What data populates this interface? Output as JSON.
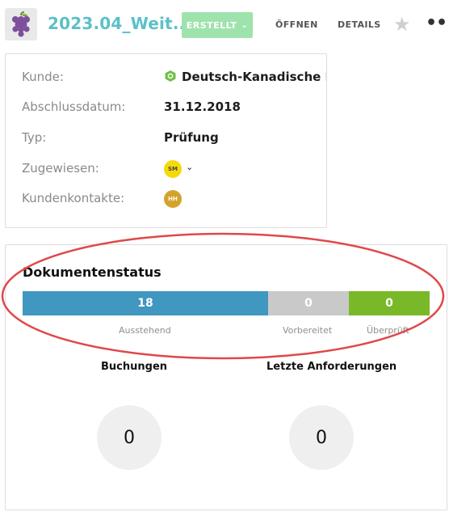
{
  "header": {
    "title": "2023.04_Weit...",
    "status_label": "ERSTELLT",
    "nav": [
      "ÖFFNEN",
      "DETAILS"
    ],
    "icons": [
      "grapes-icon",
      "chevron-down-icon",
      "star-icon",
      "more-icon"
    ]
  },
  "details": {
    "rows": [
      {
        "label": "Kunde:",
        "value": "Deutsch-Kanadische Bibl"
      },
      {
        "label": "Abschlussdatum:",
        "value": "31.12.2018"
      },
      {
        "label": "Typ:",
        "value": "Prüfung"
      },
      {
        "label": "Zugewiesen:",
        "avatar": "SM"
      },
      {
        "label": "Kundenkontakte:",
        "avatar": "HH"
      }
    ]
  },
  "document_status": {
    "title": "Dokumentenstatus",
    "segments": [
      {
        "label": "Ausstehend",
        "count": "18",
        "color": "#4097bf"
      },
      {
        "label": "Vorbereitet",
        "count": "0",
        "color": "#c9c9c9"
      },
      {
        "label": "Überprüft",
        "count": "0",
        "color": "#79b828"
      }
    ]
  },
  "bookings": {
    "title": "Buchungen",
    "value": "0"
  },
  "latest_requests": {
    "title": "Letzte Anforderungen",
    "value": "0"
  },
  "colors": {
    "accent": "#5cc0c8",
    "status_button": "#9fe3ac",
    "annotation": "#e04848"
  }
}
